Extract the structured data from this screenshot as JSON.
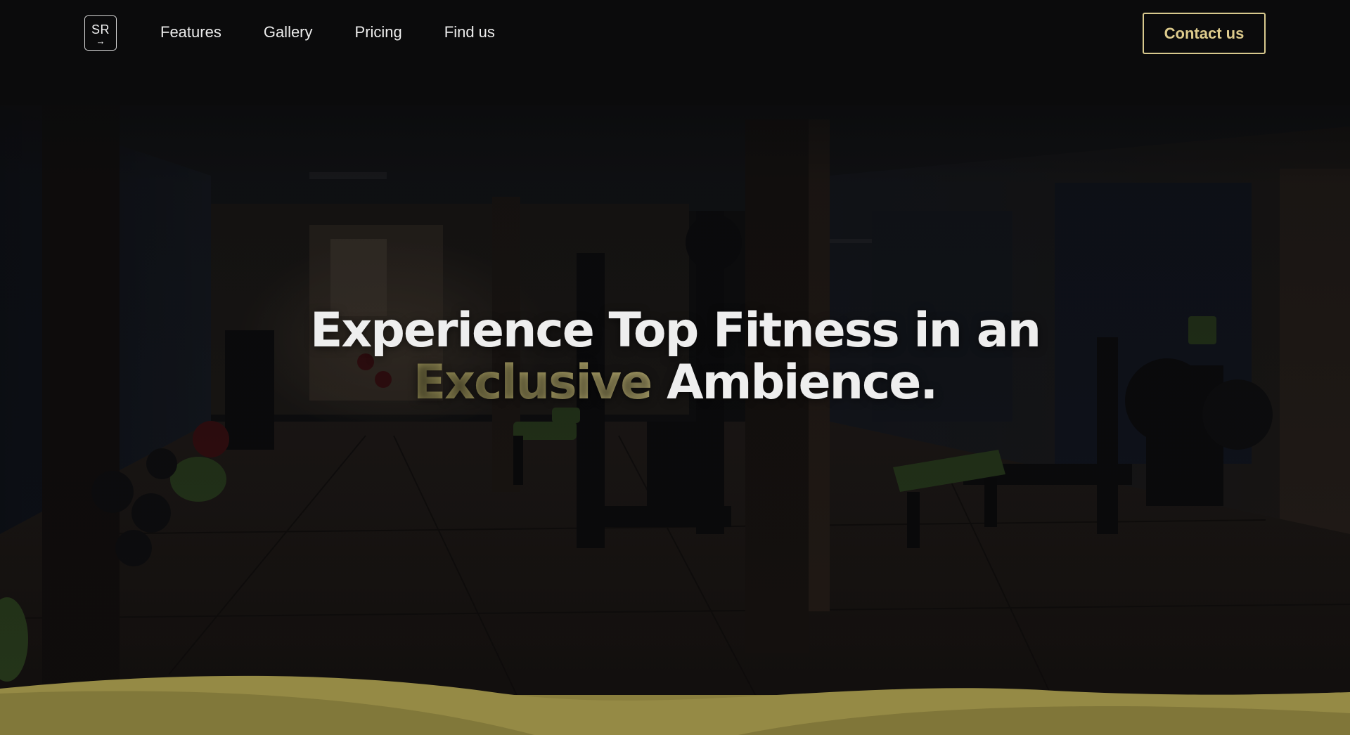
{
  "header": {
    "logo": {
      "text": "SR",
      "arrow": "→"
    },
    "nav": [
      {
        "label": "Features"
      },
      {
        "label": "Gallery"
      },
      {
        "label": "Pricing"
      },
      {
        "label": "Find us"
      }
    ],
    "contact_label": "Contact us"
  },
  "hero": {
    "headline_line1": "Experience Top Fitness in an",
    "headline_accent": "Exclusive",
    "headline_line2_rest": " Ambience."
  },
  "colors": {
    "background": "#0b0b0c",
    "accent_gold": "#d8c98e",
    "headline_accent": "#a59b60",
    "wave": "#8d8240",
    "text": "#eeeeee"
  }
}
